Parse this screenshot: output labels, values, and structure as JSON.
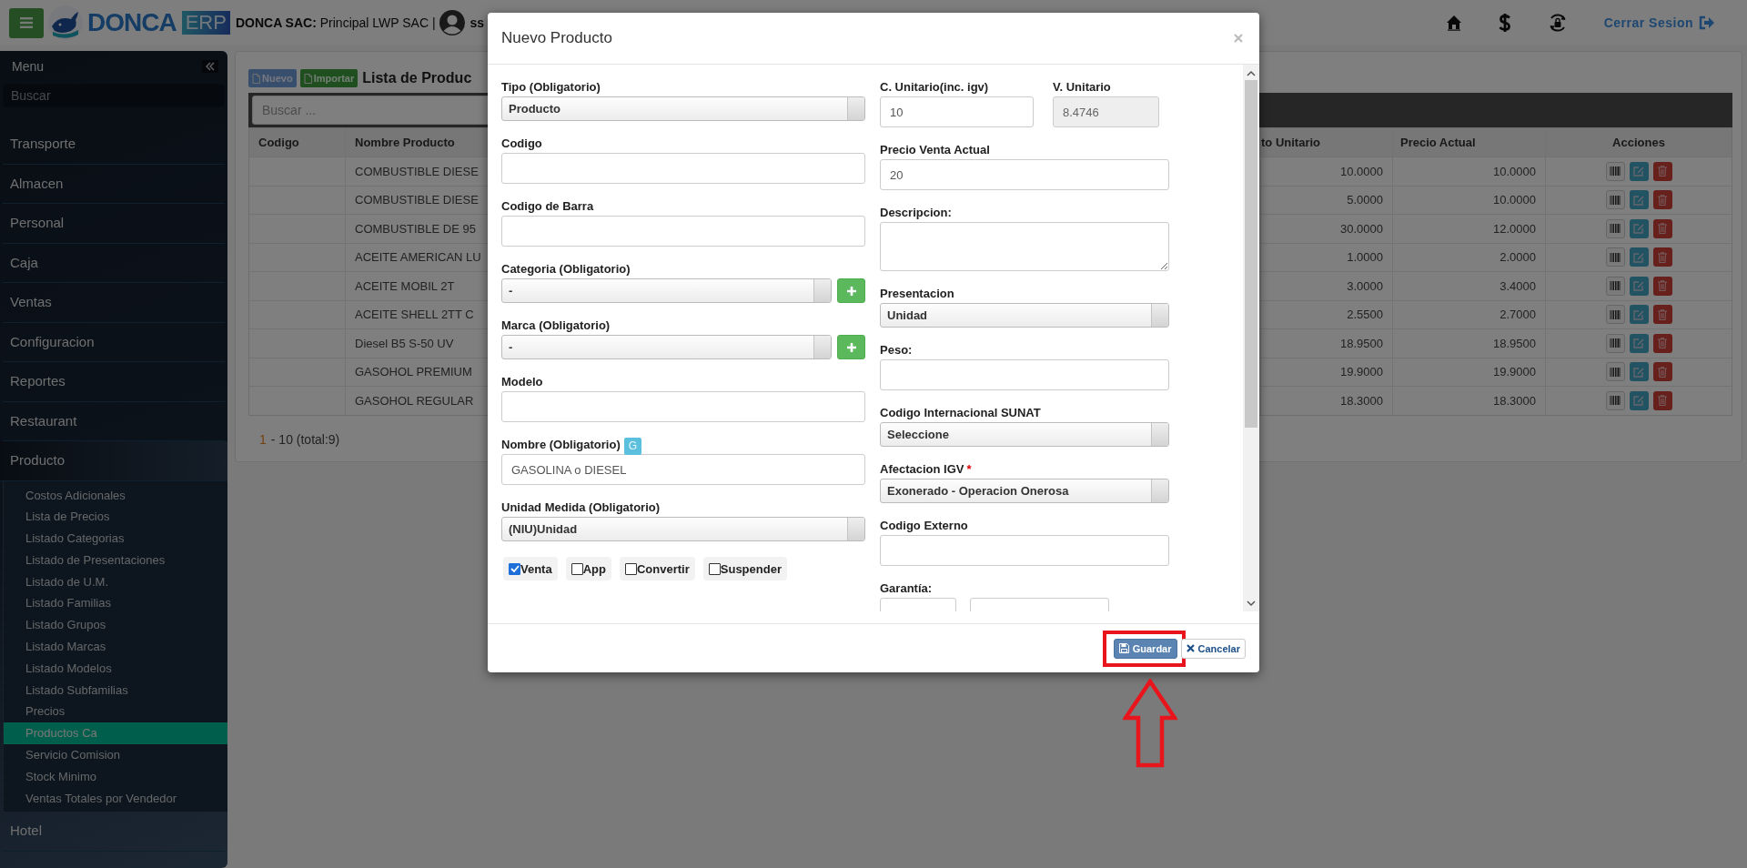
{
  "topbar": {
    "logo": {
      "name": "DONCA",
      "badge": "ERP"
    },
    "company": "**DONCA SAC:** Principal LWP SAC |",
    "user": "ss",
    "logout": "Cerrar Sesion"
  },
  "sidebar": {
    "title": "Menu",
    "search_placeholder": "Buscar",
    "items": [
      {
        "label": "Transporte",
        "expanded": false
      },
      {
        "label": "Almacen",
        "expanded": false
      },
      {
        "label": "Personal",
        "expanded": false
      },
      {
        "label": "Caja",
        "expanded": false
      },
      {
        "label": "Ventas",
        "expanded": false
      },
      {
        "label": "Configuracion",
        "expanded": false
      },
      {
        "label": "Reportes",
        "expanded": false
      },
      {
        "label": "Restaurant",
        "expanded": false
      },
      {
        "label": "Producto",
        "expanded": true,
        "children": [
          {
            "label": "Costos Adicionales",
            "selected": false
          },
          {
            "label": "Lista de Precios",
            "selected": false
          },
          {
            "label": "Listado Categorias",
            "selected": false
          },
          {
            "label": "Listado de Presentaciones",
            "selected": false
          },
          {
            "label": "Listado de U.M.",
            "selected": false
          },
          {
            "label": "Listado Familias",
            "selected": false
          },
          {
            "label": "Listado Grupos",
            "selected": false
          },
          {
            "label": "Listado Marcas",
            "selected": false
          },
          {
            "label": "Listado Modelos",
            "selected": false
          },
          {
            "label": "Listado Subfamilias",
            "selected": false
          },
          {
            "label": "Precios",
            "selected": false
          },
          {
            "label": "Productos Ca",
            "selected": true
          },
          {
            "label": "Servicio Comision",
            "selected": false
          },
          {
            "label": "Stock Minimo",
            "selected": false
          },
          {
            "label": "Ventas Totales por Vendedor",
            "selected": false
          }
        ]
      },
      {
        "label": "Hotel",
        "expanded": false
      }
    ]
  },
  "panel": {
    "buttons": [
      {
        "label": "Nuevo",
        "kind": "primary"
      },
      {
        "label": "Importar",
        "kind": "success"
      }
    ],
    "title": "Lista de Produc",
    "search_placeholder": "Buscar ...",
    "table": {
      "columns": [
        "Codigo",
        "Nombre Producto",
        "to Unitario",
        "Precio Actual",
        "Acciones"
      ],
      "rows": [
        {
          "nombre_producto": "COMBUSTIBLE DIESE",
          "column_3": "10.0000",
          "precio_actual": "10.0000"
        },
        {
          "nombre_producto": "COMBUSTIBLE DIESE",
          "column_3": "5.0000",
          "precio_actual": "10.0000"
        },
        {
          "nombre_producto": "COMBUSTIBLE DE 95",
          "column_3": "30.0000",
          "precio_actual": "12.0000"
        },
        {
          "nombre_producto": "ACEITE AMERICAN LU",
          "column_3": "1.0000",
          "precio_actual": "2.0000"
        },
        {
          "nombre_producto": "ACEITE MOBIL 2T",
          "column_3": "3.0000",
          "precio_actual": "3.4000"
        },
        {
          "nombre_producto": "ACEITE SHELL 2TT C",
          "column_3": "2.5500",
          "precio_actual": "2.7000"
        },
        {
          "nombre_producto": "Diesel B5 S-50 UV",
          "column_3": "18.9500",
          "precio_actual": "18.9500"
        },
        {
          "nombre_producto": "GASOHOL PREMIUM",
          "column_3": "19.9000",
          "precio_actual": "19.9000"
        },
        {
          "nombre_producto": "GASOHOL REGULAR",
          "column_3": "18.3000",
          "precio_actual": "18.3000"
        }
      ]
    },
    "pagination": {
      "current": "1",
      "summary": "- 10 (total:9)"
    }
  },
  "modal": {
    "title": "Nuevo Producto",
    "left_fields": [
      {
        "kind": "select",
        "label": "Tipo (Obligatorio)",
        "value": "Producto"
      },
      {
        "kind": "input",
        "label": "Codigo"
      },
      {
        "kind": "input",
        "label": "Codigo de Barra"
      },
      {
        "kind": "select",
        "label": "Categoria (Obligatorio)",
        "value": "-",
        "add_button": true
      },
      {
        "kind": "select",
        "label": "Marca (Obligatorio)",
        "value": "-",
        "add_button": true
      },
      {
        "kind": "input",
        "label": "Modelo"
      },
      {
        "kind": "input",
        "label": "Nombre (Obligatorio)",
        "badge": "G",
        "value": "GASOLINA o DIESEL"
      },
      {
        "kind": "select",
        "label": "Unidad Medida (Obligatorio)",
        "value": "(NIU)Unidad"
      }
    ],
    "checkboxes": [
      {
        "label": "Venta",
        "checked": true
      },
      {
        "label": "App",
        "checked": false
      },
      {
        "label": "Convertir",
        "checked": false
      },
      {
        "label": "Suspender",
        "checked": false
      }
    ],
    "right_fields": [
      {
        "kind": "pair",
        "fields": [
          {
            "label": "C. Unitario(inc. igv)",
            "value": "10",
            "disabled": false
          },
          {
            "label": "V. Unitario",
            "value": "8.4746",
            "disabled": true
          }
        ]
      },
      {
        "kind": "input",
        "label": "Precio Venta Actual",
        "value": "20"
      },
      {
        "kind": "textarea",
        "label": "Descripcion:"
      },
      {
        "kind": "select",
        "label": "Presentacion",
        "value": "Unidad"
      },
      {
        "kind": "input",
        "label": "Peso:"
      },
      {
        "kind": "select",
        "label": "Codigo Internacional SUNAT",
        "value": "Seleccione"
      },
      {
        "kind": "select",
        "label": "Afectacion IGV",
        "required_mark": "*",
        "value": "Exonerado - Operacion Onerosa"
      },
      {
        "kind": "input",
        "label": "Codigo Externo"
      },
      {
        "kind": "split",
        "label": "Garantía:"
      }
    ],
    "buttons": [
      {
        "label": "Guardar",
        "kind": "primary",
        "highlighted": true
      },
      {
        "label": "Cancelar",
        "kind": "default",
        "highlighted": false
      }
    ]
  }
}
